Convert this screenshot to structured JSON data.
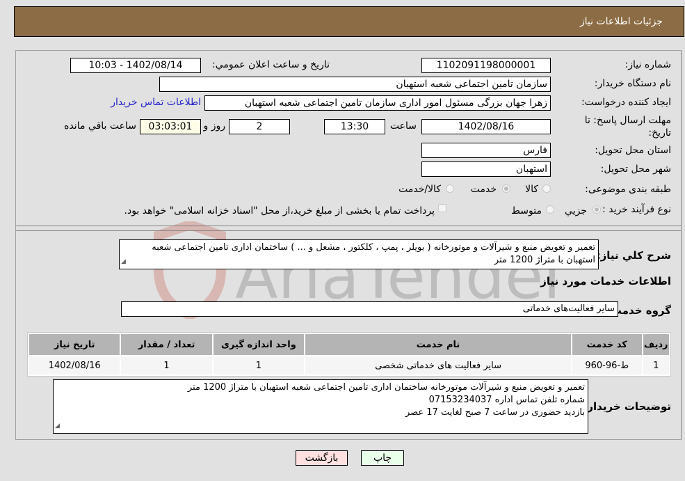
{
  "header": {
    "title": "جزئیات اطلاعات نیاز"
  },
  "form": {
    "need_number": {
      "label": "شماره نیاز:",
      "value": "1102091198000001"
    },
    "announce_datetime": {
      "label": "تاریخ و ساعت اعلان عمومي:",
      "value": "1402/08/14 - 10:03"
    },
    "buyer_org": {
      "label": "نام دستگاه خریدار:",
      "value": "سازمان تامین اجتماعی شعبه استهبان"
    },
    "requester": {
      "label": "ایجاد کننده درخواست:",
      "value": "زهرا جهان بزرگی مسئول امور اداری سازمان تامین اجتماعی شعبه استهبان"
    },
    "buyer_contact_link": "اطلاعات تماس خریدار",
    "deadline": {
      "label": "مهلت ارسال پاسخ: تا تاریخ:",
      "date": "1402/08/16",
      "time_label": "ساعت",
      "time": "13:30",
      "days": "2",
      "days_label": "روز و",
      "remaining": "03:03:01",
      "remaining_label": "ساعت باقي مانده"
    },
    "province": {
      "label": "استان محل تحویل:",
      "value": "فارس"
    },
    "city": {
      "label": "شهر محل تحویل:",
      "value": "استهبان"
    },
    "category": {
      "label": "طبقه بندی موضوعی:",
      "options": [
        "کالا",
        "خدمت",
        "کالا/خدمت"
      ],
      "selected": "خدمت"
    },
    "purchase_type": {
      "label": "نوع فرآیند خرید :",
      "options": [
        "جزيي",
        "متوسط"
      ],
      "selected": "جزيي",
      "treasury_note": "پرداخت تمام یا بخشی از مبلغ خرید،از محل \"اسناد خزانه اسلامی\" خواهد بود."
    },
    "description": {
      "label": "شرح کلي نیاز:",
      "value": "تعمیر و تعویض منبع و شیرآلات و موتورخانه ( بویلر ، پمپ ، کلکتور ، مشعل و ... ) ساختمان اداری تامین اجتماعی شعبه استهبان با متراژ 1200 متر"
    }
  },
  "services_section": {
    "title": "اطلاعات خدمات مورد نیاز",
    "group_label": "گروه خدمت:",
    "group_value": "سایر فعالیت‌های خدماتی",
    "table": {
      "headers": [
        "ردیف",
        "کد خدمت",
        "نام خدمت",
        "واحد اندازه گیری",
        "تعداد / مقدار",
        "تاریخ نیاز"
      ],
      "rows": [
        [
          "1",
          "ط-96-960",
          "سایر فعالیت های خدماتی شخصی",
          "1",
          "1",
          "1402/08/16"
        ]
      ]
    }
  },
  "buyer_notes": {
    "label": "توضیحات خریدار:",
    "lines": [
      "تعمیر و تعویض منبع و شیرآلات موتورخانه ساختمان اداری تامین اجتماعی شعبه استهبان با متراژ 1200 متر",
      "شماره تلفن تماس اداره  07153234037",
      "بازدید حضوری در ساعت 7 صبح لغایت 17 عصر"
    ]
  },
  "buttons": {
    "print": "چاپ",
    "back": "بازگشت"
  },
  "colors": {
    "header_bg": "#8b6c44",
    "print_bg": "#eaffea",
    "back_bg": "#ffe0e0",
    "link": "#2222cc"
  }
}
